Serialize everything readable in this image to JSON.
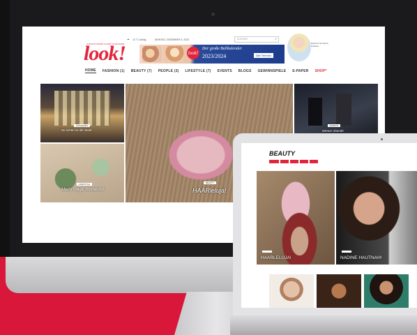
{
  "colors": {
    "brand": "#e1263c",
    "background": "#d8173a"
  },
  "desktop": {
    "weather": "12 °C wolkig",
    "date": "MONTAG, DEZEMBER 4, 2023",
    "search_placeholder": "SUCHEN",
    "logo_tagline": "AUSTRIAS FASHION & LIFESTYLE MAGAZINE",
    "logo": "look!",
    "banner": {
      "line1": "Der große Ballkalender",
      "line2": "2023/2024",
      "button": "Alle Termine"
    },
    "profile_text": "Exklusiv bei Zarah Kulhava",
    "nav": [
      {
        "label": "HOME"
      },
      {
        "label": "FASHION (1)"
      },
      {
        "label": "BEAUTY (7)"
      },
      {
        "label": "PEOPLE (3)"
      },
      {
        "label": "LIFESTYLE (7)"
      },
      {
        "label": "EVENTS"
      },
      {
        "label": "BLOGS"
      },
      {
        "label": "GEWINNSPIELE"
      },
      {
        "label": "E-PAPER"
      },
      {
        "label": "SHOP*"
      }
    ],
    "tiles": {
      "t1_label": "So schön ist die Stadt",
      "t1_tag": "AUSGEHEN",
      "t2_label": "Merry magic moments!",
      "t2_tag": "LIFESTYLE",
      "t3_label": "HAARleluja!",
      "t3_tag": "BEAUTY",
      "t4_label": "Wiener Abende",
      "t4_tag": "EVENTS"
    }
  },
  "laptop": {
    "section_title": "BEAUTY",
    "chips": [
      "",
      "",
      "",
      "",
      ""
    ],
    "tile1_label": "HAARLELUJA!",
    "tile2_label": "NADINE HAUTNAH!"
  }
}
